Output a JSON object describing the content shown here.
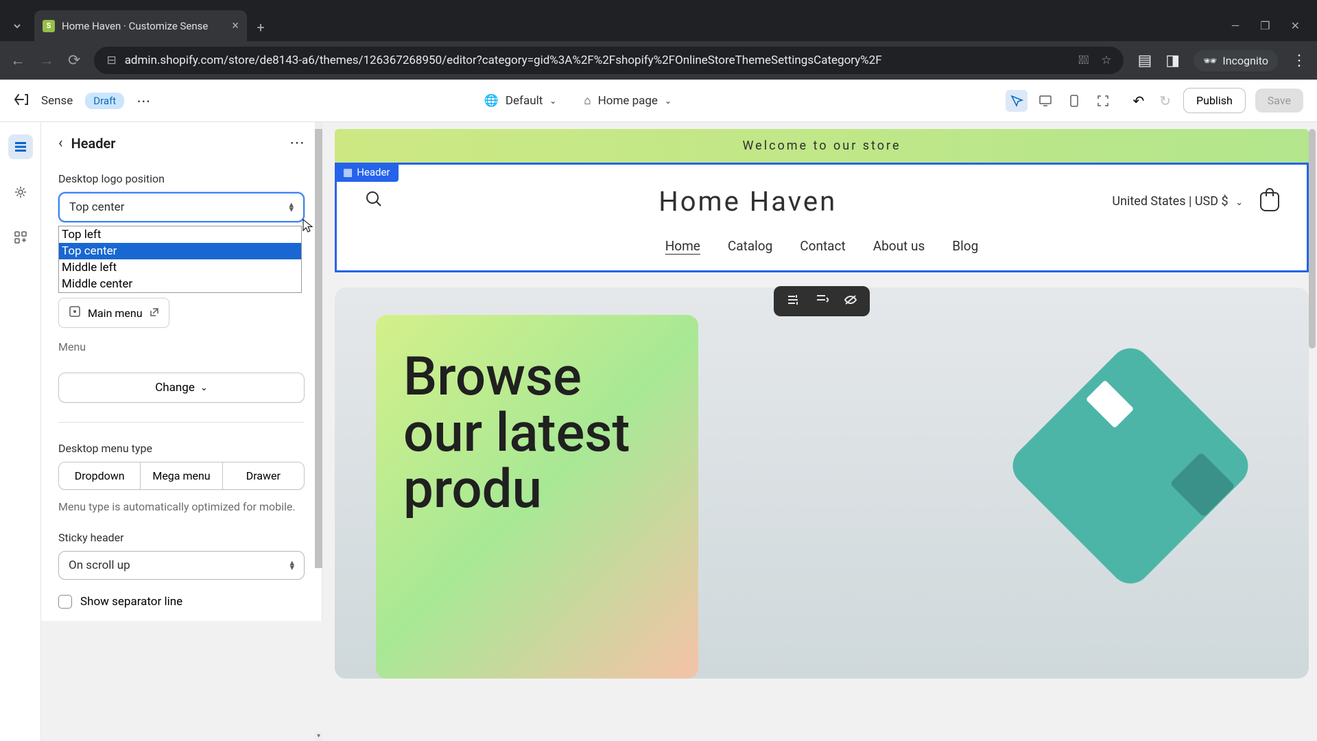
{
  "browser": {
    "tab_title": "Home Haven · Customize Sense",
    "url": "admin.shopify.com/store/de8143-a6/themes/126367268950/editor?category=gid%3A%2F%2Fshopify%2FOnlineStoreThemeSettingsCategory%2F",
    "incognito_label": "Incognito"
  },
  "toolbar": {
    "theme_name": "Sense",
    "draft_label": "Draft",
    "template_label": "Default",
    "page_label": "Home page",
    "publish_label": "Publish",
    "save_label": "Save"
  },
  "sidebar": {
    "title": "Header",
    "logo_position": {
      "label": "Desktop logo position",
      "value": "Top center",
      "options": [
        "Top left",
        "Top center",
        "Middle left",
        "Middle center"
      ],
      "selected_index": 1
    },
    "menu": {
      "link_text": "Main menu",
      "label": "Menu",
      "change_label": "Change"
    },
    "menu_type": {
      "label": "Desktop menu type",
      "options": [
        "Dropdown",
        "Mega menu",
        "Drawer"
      ],
      "helper": "Menu type is automatically optimized for mobile."
    },
    "sticky": {
      "label": "Sticky header",
      "value": "On scroll up"
    },
    "separator_label": "Show separator line"
  },
  "preview": {
    "announcement": "Welcome to our store",
    "header_tag": "Header",
    "store_name": "Home Haven",
    "locale": "United States | USD $",
    "nav": [
      "Home",
      "Catalog",
      "Contact",
      "About us",
      "Blog"
    ],
    "hero_text": "Browse our latest produ"
  }
}
